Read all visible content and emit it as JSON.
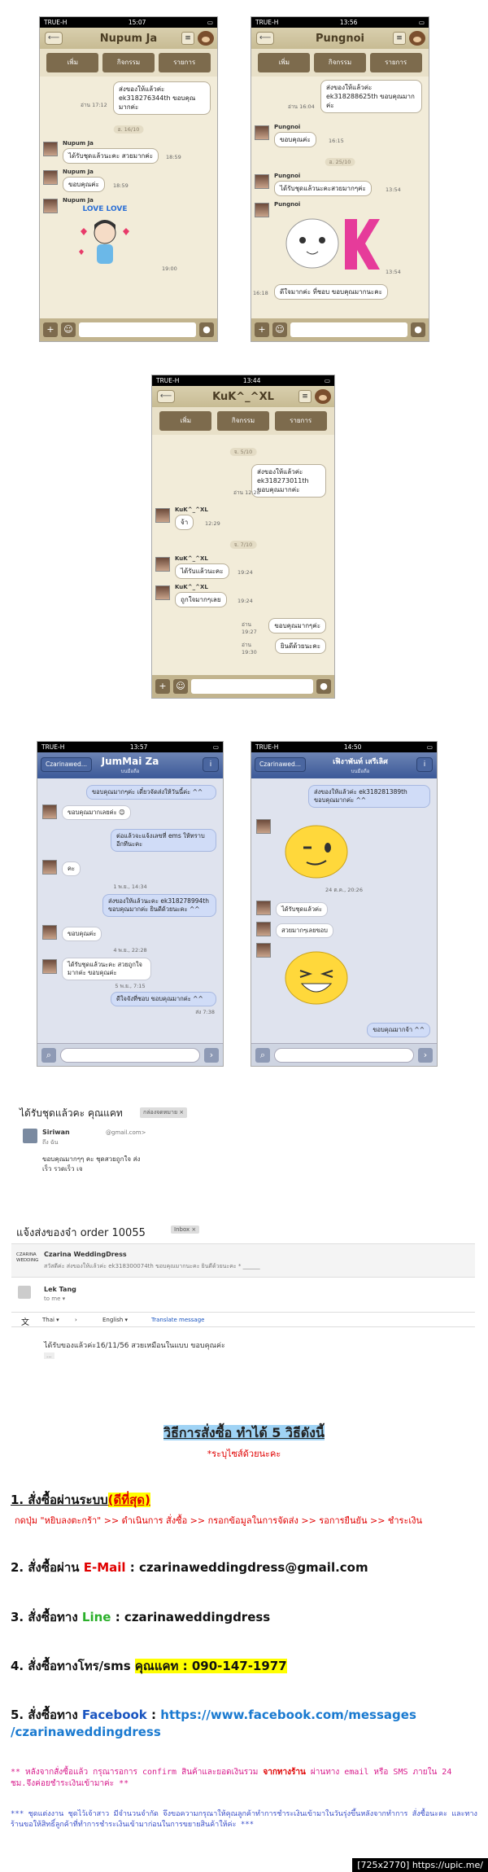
{
  "phones": {
    "status": {
      "carrier": "TRUE-H"
    },
    "p1": {
      "time": "15:07",
      "title": "Nupum Ja",
      "btns": [
        "เพิ่ม",
        "กิจกรรม",
        "รายการ"
      ],
      "msgs": {
        "out1": "ส่งของให้แล้วค่ะ ek318276344th ขอบคุณมากค่ะ",
        "out1_time": "อ่าน 17:12",
        "div1": "อ. 16/10",
        "name": "Nupum Ja",
        "in1": "ได้รับชุดแล้วนะคะ สวยมากค่ะ",
        "in1_time": "18:59",
        "in2": "ขอบคุณค่ะ",
        "in2_time": "18:59",
        "sticker_time": "19:00",
        "sticker_text": "LOVE LOVE"
      }
    },
    "p2": {
      "time": "13:56",
      "title": "Pungnoi",
      "btns": [
        "เพิ่ม",
        "กิจกรรม",
        "รายการ"
      ],
      "msgs": {
        "out1": "ส่งของให้แล้วค่ะ ek318288625th ขอบคุณมากค่ะ",
        "out1_time": "อ่าน 16:04",
        "name": "Pungnoi",
        "in1": "ขอบคุณค่ะ",
        "in1_time": "16:15",
        "div1": "อ. 25/10",
        "in2": "ได้รับชุดแล้วนะคะสวยมากๆค่ะ",
        "in2_time": "13:54",
        "sticker_time": "13:54",
        "in3": "ดีใจมากค่ะ ที่ชอบ ขอบคุณมากนะคะ",
        "in3_time": "16:18"
      }
    },
    "p3": {
      "time": "13:44",
      "title": "KuK^_^XL",
      "btns": [
        "เพิ่ม",
        "กิจกรรม",
        "รายการ"
      ],
      "msgs": {
        "div1": "จ. 5/10",
        "out1": "ส่งของให้แล้วค่ะ ek318273011th ขอบคุณมากค่ะ",
        "out1_time": "อ่าน 12:28",
        "name": "KuK^_^XL",
        "in1": "จ้า",
        "in1_time": "12:29",
        "div2": "จ. 7/10",
        "in2": "ได้รับแล้วนะคะ",
        "in2_time": "19:24",
        "in3": "ถูกใจมากๆเลย",
        "in3_time": "19:24",
        "out2": "ขอบคุณมากๆค่ะ",
        "out2_time": "อ่าน 19:27",
        "out3": "ยินดีด้วยนะคะ",
        "out3_time": "อ่าน 19:30"
      }
    },
    "p4": {
      "carrier": "TRUE-H",
      "time": "13:57",
      "back": "Czarinawed...",
      "title": "JumMai Za",
      "sub": "บนมือถือ",
      "msgs": {
        "out1": "ขอบคุณมากๆค่ะ เดี๋ยวจัดส่งให้วันนี้ค่ะ ^^",
        "in1": "ขอบคุณมากเลยค่ะ 😊",
        "out2": "ต่อแล้วจะแจ้งเลขที่ ems ให้ทราบอีกทีนะคะ",
        "in2": "คะ",
        "div1": "1 พ.ย., 14:34",
        "out3": "ส่งของให้แล้วนะคะ ek318278994th ขอบคุณมากค่ะ ยินดีด้วยนะคะ ^^",
        "in3": "ขอบคุณค่ะ",
        "div2": "4 พ.ย., 22:28",
        "in4": "ได้รับชุดแล้วนะคะ สวยถูกใจมากค่ะ ขอบคุณค่ะ",
        "div3": "5 พ.ย., 7:15",
        "out4": "ดีใจจังที่ชอบ ขอบคุณมากค่ะ ^^",
        "seen": "ส่ง 7:38"
      }
    },
    "p5": {
      "carrier": "TRUE-H",
      "time": "14:50",
      "back": "Czarinawed...",
      "title": "เฟิงาพันท์ เสรีเลิศ",
      "sub": "บนมือถือ",
      "msgs": {
        "out1": "ส่งของให้แล้วค่ะ ek318281389th ขอบคุณมากค่ะ ^^",
        "div1": "24 ต.ค., 20:26",
        "in1": "ได้รับชุดแล้วค่ะ",
        "in2": "สวยมากๆเลยขอบ",
        "out2": "ขอบคุณมากจ้า ^^"
      }
    }
  },
  "email1": {
    "subject": "ได้รับชุดแล้วคะ คุณแคท",
    "tag": "กล่องจดหมาย ×",
    "sender": "Siriwan",
    "sender_email": "@gmail.com>",
    "to": "ถึง ฉัน",
    "body": "ขอบคุณมากๆๆ คะ ชุดสวยถูกใจ ส่งเร็ว รวดเร็ว เจ"
  },
  "email2": {
    "subject": "แจ้งส่งของจ๋า order 10055",
    "tag": "Inbox ×",
    "logo": "CZARINA WEDDING",
    "shop": "Czarina WeddingDress",
    "snippet": "สวัสดีค่ะ ส่งของให้แล้วค่ะ ek318300074th ขอบคุณมากนะคะ ยินดีด้วยนะคะ * ______",
    "replier": "Lek Tang",
    "to": "to me ▾",
    "lang_from": "Thai ▾",
    "arrow": "›",
    "lang_to": "English ▾",
    "translate": "Translate message",
    "reply": "ได้รับของแล้วค่ะ16/11/56 สวยเหมือนในแบบ ขอบคุณค่ะ",
    "dots": "..."
  },
  "instructions": {
    "title": "วิธีการสั่งซื้อ ทำได้ 5 วิธีดังนี้",
    "subtitle": "*ระบุไซส์ด้วยนะคะ",
    "s1_prefix": "1. สั่งซื้อผ่านระบบ",
    "s1_hl": "(ดีที่สุด)",
    "s1_detail": "กดปุ่ม \"หยิบลงตะกร้า\" >> ดำเนินการ สั่งซื้อ >> กรอกข้อมูลในการจัดส่ง >> รอการยืนยัน >> ชำระเงิน",
    "s2_prefix": "2. สั่งซื้อผ่าน",
    "s2_label": "E-Mail",
    "s2_value": ": czarinaweddingdress@gmail.com",
    "s3_prefix": "3. สั่งซื้อทาง",
    "s3_label": "Line",
    "s3_value": ": czarinaweddingdress",
    "s4_prefix": "4. สั่งซื้อทางโทร/sms",
    "s4_value": "คุณแคท : 090-147-1977",
    "s5_prefix": "5. สั่งซื้อทาง",
    "s5_label": "Facebook",
    "s5_sep": ":",
    "s5_url1": "https://www.facebook.com/messages",
    "s5_url2": "/czarinaweddingdress",
    "note1a": "** หลังจากสั่งซื้อแล้ว กรุณารอการ confirm สินค้าและยอดเงินรวม",
    "note1b": "จากทางร้าน",
    "note1c": "ผ่านทาง email หรือ SMS ภายใน 24 ชม.จึงค่อยชำระเงินเข้ามาค่ะ **",
    "note2": "*** ชุดแต่งงาน ชุดไว้เจ้าสาว มีจำนวนจำกัด จึงขอความกรุณาให้คุณลูกค้าทำการชำระเงินเข้ามาในวันรุ่งขึ้นหลังจากทำการ สั่งซื้อนะคะ และทางร้านขอให้สิทธิ์ลูกค้าที่ทำการชำระเงินเข้ามาก่อนในการขยายสินค้าให้ค่ะ ***"
  },
  "watermark": "[725x2770] https://upic.me/",
  "colors": {
    "red": "#e00000",
    "green": "#2bb02b",
    "blue": "#1a55c0",
    "highlight": "#ffff00",
    "title_bg": "#9fd3f5"
  }
}
